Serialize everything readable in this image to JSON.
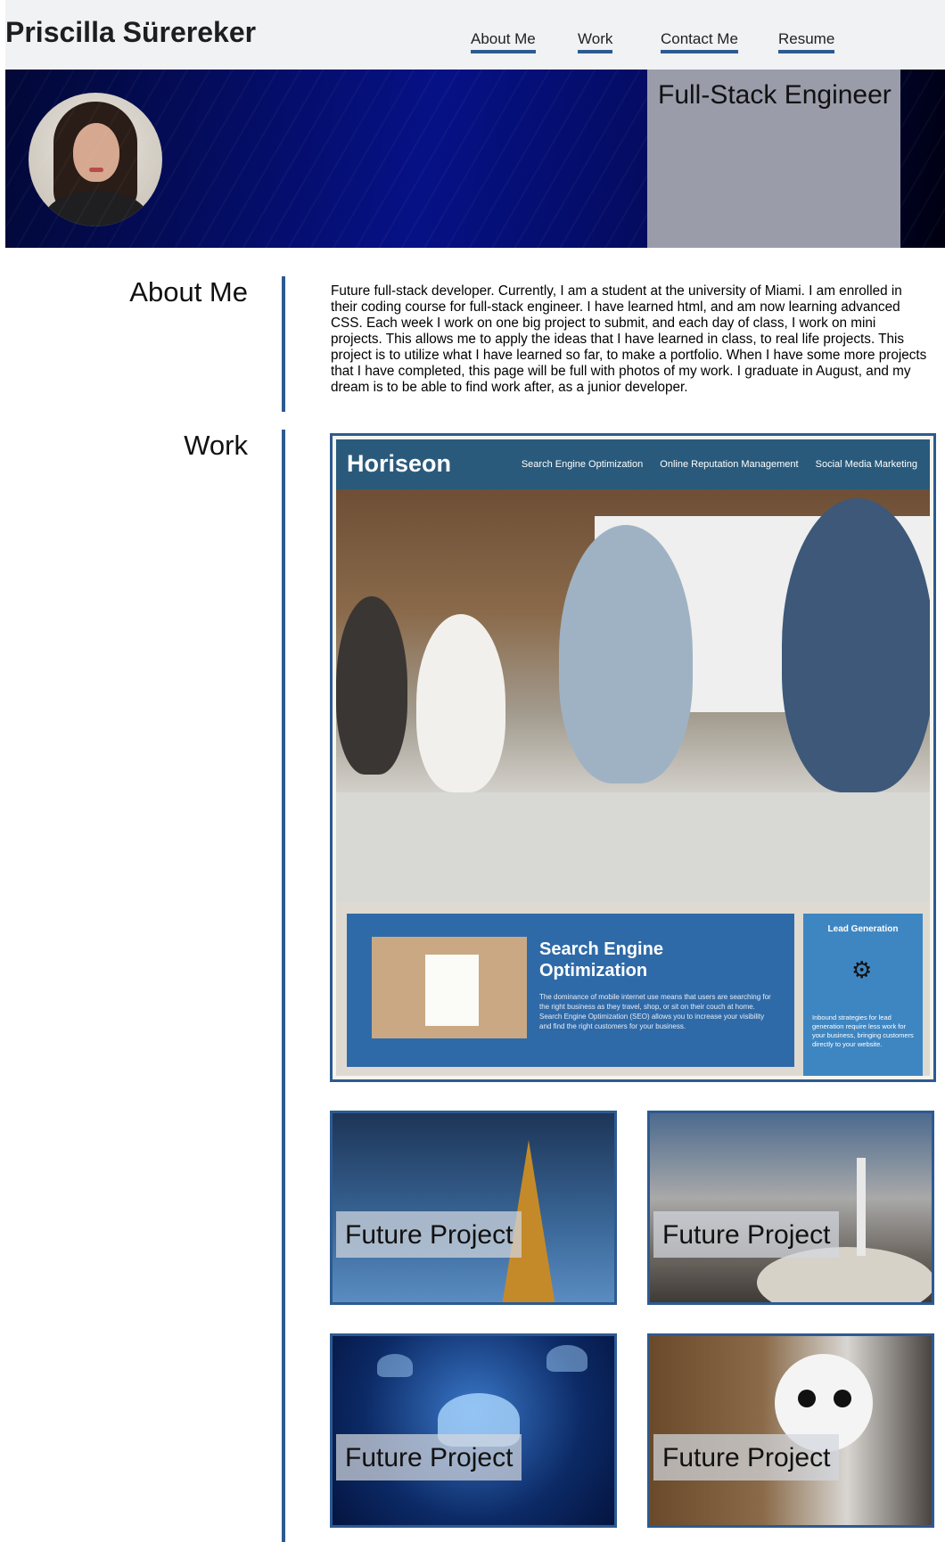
{
  "header": {
    "site_name": "Priscilla Sürereker",
    "nav": [
      "About Me",
      "Work",
      "Contact Me",
      "Resume"
    ]
  },
  "hero": {
    "role": "Full-Stack Engineer"
  },
  "about": {
    "title": "About Me",
    "text": "Future full-stack developer. Currently, I am a student at the university of Miami. I am enrolled in their coding course for full-stack engineer. I have learned html, and am now learning advanced CSS. Each week I work on one big project to submit, and each day of class, I work on mini projects. This allows me to apply the ideas that I have learned in class, to real life projects. This project is to utilize what I have learned so far, to make a portfolio. When I have some more projects that I have completed, this page will be full with photos of my work. I graduate in August, and my dream is to be able to find work after, as a junior developer."
  },
  "work": {
    "title": "Work",
    "featured": {
      "logo": "Horiseon",
      "nav": [
        "Search Engine Optimization",
        "Online Reputation Management",
        "Social Media Marketing"
      ],
      "seo_title": "Search Engine Optimization",
      "seo_text": "The dominance of mobile internet use means that users are searching for the right business as they travel, shop, or sit on their couch at home. Search Engine Optimization (SEO) allows you to increase your visibility and find the right customers for your business.",
      "lead_title": "Lead Generation",
      "lead_text": "Inbound strategies for lead generation require less work for your business, bringing customers directly to your website."
    },
    "future_projects": [
      "Future Project",
      "Future Project",
      "Future Project",
      "Future Project"
    ]
  },
  "colors": {
    "accent": "#2d5a91",
    "header_bg": "#f1f2f4",
    "hero_bg": "#061186",
    "role_box": "#9a9caa"
  }
}
